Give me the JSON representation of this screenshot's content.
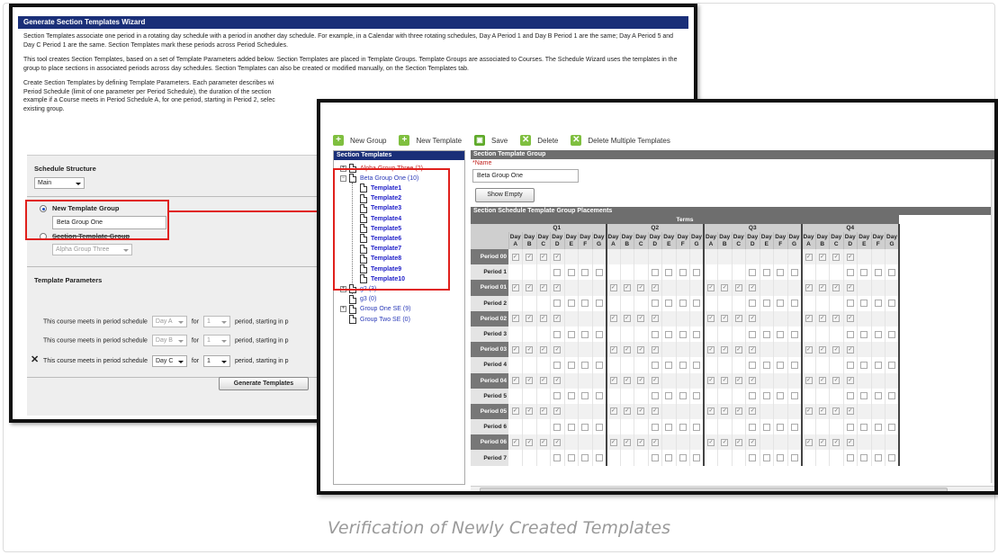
{
  "caption": "Verification of Newly Created Templates",
  "wizard": {
    "title": "Generate Section Templates Wizard",
    "para1": "Section Templates associate one period in a rotating day schedule with a period in another day schedule. For example, in a Calendar with three rotating schedules, Day A Period 1 and Day B Period 1 are the same; Day A Period 5 and Day C Period 1 are the same. Section Templates mark these periods across Period Schedules.",
    "para2": "This tool creates Section Templates, based on a set of Template Parameters added below. Section Templates are placed in Template Groups. Template Groups are associated to Courses. The Schedule Wizard uses the templates in the group to place sections in associated periods across day schedules. Section Templates can also be created or modified manually, on the Section Templates tab.",
    "para3": "Create Section Templates by defining Template Parameters. Each parameter describes wi Period Schedule (limit of one parameter per Period Schedule), the duration of the section example if a Course meets in Period Schedule A, for one period, starting in Period 2, selec existing group.",
    "schedule_structure_label": "Schedule Structure",
    "schedule_structure_value": "Main",
    "new_group_label": "New Template Group",
    "new_group_value": "Beta Group One",
    "section_group_label": "Section Template Group",
    "section_group_value": "Alpha Group Three",
    "template_params_label": "Template Parameters",
    "params": [
      {
        "prefix": "This course meets in period schedule",
        "day": "Day A",
        "for": "for",
        "count": "1",
        "suffix": "period, starting in p"
      },
      {
        "prefix": "This course meets in period schedule",
        "day": "Day B",
        "for": "for",
        "count": "1",
        "suffix": "period, starting in p"
      },
      {
        "prefix": "This course meets in period schedule",
        "day": "Day C",
        "for": "for",
        "count": "1",
        "suffix": "period, starting in p"
      }
    ],
    "generate_button": "Generate Templates"
  },
  "toolbar": {
    "new_group": "New Group",
    "new_template": "New Template",
    "save": "Save",
    "delete": "Delete",
    "delete_multiple": "Delete Multiple Templates"
  },
  "tree": {
    "header": "Section Templates",
    "groups": [
      {
        "label": "Alpha Group Three (2)"
      },
      {
        "label": "Beta Group One (10)"
      },
      {
        "label": "g2 (3)"
      },
      {
        "label": "g3 (0)"
      },
      {
        "label": "Group One SE (9)"
      },
      {
        "label": "Group Two SE (0)"
      }
    ],
    "templates": [
      "Template1",
      "Template2",
      "Template3",
      "Template4",
      "Template5",
      "Template6",
      "Template7",
      "Template8",
      "Template9",
      "Template10"
    ]
  },
  "group_panel": {
    "header": "Section Template Group",
    "name_label": "*Name",
    "name_value": "Beta Group One",
    "show_empty": "Show Empty"
  },
  "placements": {
    "header": "Section Schedule Template Group Placements",
    "terms_label": "Terms",
    "terms": [
      "Q1",
      "Q2",
      "Q3",
      "Q4"
    ],
    "day_word": "Day",
    "days": [
      "A",
      "B",
      "C",
      "D",
      "E",
      "F",
      "G"
    ],
    "periods": [
      "Period 00",
      "Period 1",
      "Period 01",
      "Period 2",
      "Period 02",
      "Period 3",
      "Period 03",
      "Period 4",
      "Period 04",
      "Period 5",
      "Period 05",
      "Period 6",
      "Period 06",
      "Period 7"
    ]
  }
}
